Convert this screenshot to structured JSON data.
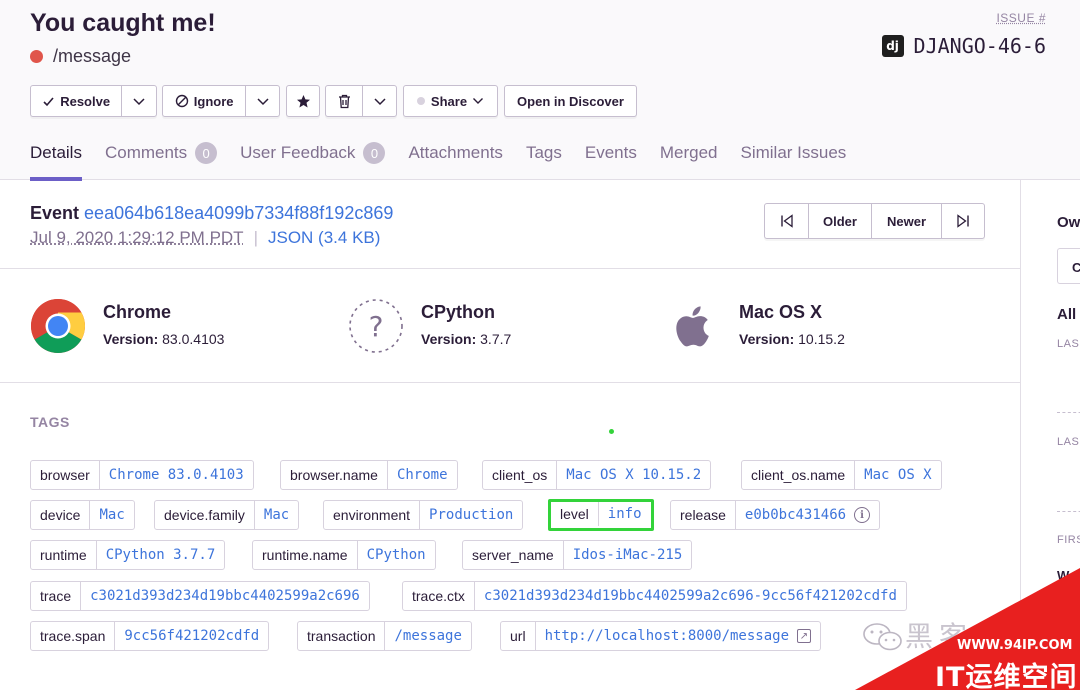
{
  "header": {
    "title": "You caught me!",
    "culprit": "/message",
    "issue_label": "ISSUE #",
    "issue_id": "DJANGO-46-6",
    "logo_text": "dj"
  },
  "actions": {
    "resolve": "Resolve",
    "ignore": "Ignore",
    "share": "Share",
    "discover": "Open in Discover"
  },
  "tabs": [
    {
      "label": "Details",
      "active": true
    },
    {
      "label": "Comments",
      "badge": "0"
    },
    {
      "label": "User Feedback",
      "badge": "0"
    },
    {
      "label": "Attachments"
    },
    {
      "label": "Tags"
    },
    {
      "label": "Events"
    },
    {
      "label": "Merged"
    },
    {
      "label": "Similar Issues"
    }
  ],
  "event": {
    "label": "Event",
    "id": "eea064b618ea4099b7334f88f192c869",
    "date": "Jul 9, 2020 1:29:12 PM PDT",
    "json": "JSON (3.4 KB)",
    "older": "Older",
    "newer": "Newer"
  },
  "contexts": [
    {
      "name": "Chrome",
      "version_label": "Version:",
      "version": "83.0.4103",
      "icon": "chrome-icon"
    },
    {
      "name": "CPython",
      "version_label": "Version:",
      "version": "3.7.7",
      "icon": "unknown-icon"
    },
    {
      "name": "Mac OS X",
      "version_label": "Version:",
      "version": "10.15.2",
      "icon": "apple-icon"
    }
  ],
  "tags_title": "TAGS",
  "tags": [
    {
      "key": "browser",
      "value": "Chrome 83.0.4103"
    },
    {
      "key": "browser.name",
      "value": "Chrome"
    },
    {
      "key": "client_os",
      "value": "Mac OS X 10.15.2"
    },
    {
      "key": "client_os.name",
      "value": "Mac OS X"
    },
    {
      "key": "device",
      "value": "Mac"
    },
    {
      "key": "device.family",
      "value": "Mac"
    },
    {
      "key": "environment",
      "value": "Production"
    },
    {
      "key": "level",
      "value": "info",
      "highlighted": true
    },
    {
      "key": "release",
      "value": "e0b0bc431466"
    },
    {
      "key": "runtime",
      "value": "CPython 3.7.7"
    },
    {
      "key": "runtime.name",
      "value": "CPython"
    },
    {
      "key": "server_name",
      "value": "Idos-iMac-215"
    },
    {
      "key": "trace",
      "value": "c3021d393d234d19bbc4402599a2c696"
    },
    {
      "key": "trace.ctx",
      "value": "c3021d393d234d19bbc4402599a2c696-9cc56f421202cdfd"
    },
    {
      "key": "trace.span",
      "value": "9cc56f421202cdfd"
    },
    {
      "key": "transaction",
      "value": "/message"
    },
    {
      "key": "url",
      "value": "http://localhost:8000/message"
    }
  ],
  "sidebar": {
    "owner_label": "Ow",
    "input_text": "C",
    "all_label": "All",
    "last_seen_1": "LAS",
    "last_seen_2": "LAS",
    "first_seen": "FIRS",
    "w": "W"
  },
  "watermark": {
    "text": "黑客",
    "url": "WWW.94IP.COM",
    "cn": "IT运维空间"
  },
  "colors": {
    "accent": "#6c5fc7",
    "link": "#3d74db",
    "highlight": "#33d33a",
    "error_dot": "#e0554b"
  }
}
